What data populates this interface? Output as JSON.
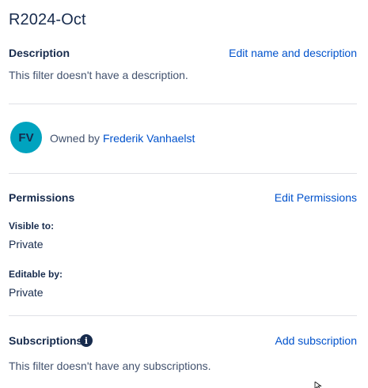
{
  "filter": {
    "title": "R2024-Oct"
  },
  "description": {
    "heading": "Description",
    "edit_link": "Edit name and description",
    "text": "This filter doesn't have a description."
  },
  "owner": {
    "avatar_initials": "FV",
    "prefix": "Owned by ",
    "name": "Frederik Vanhaelst"
  },
  "permissions": {
    "heading": "Permissions",
    "edit_link": "Edit Permissions",
    "visible_label": "Visible to:",
    "visible_value": "Private",
    "editable_label": "Editable by:",
    "editable_value": "Private"
  },
  "subscriptions": {
    "heading": "Subscriptions",
    "info_icon": "info-icon",
    "add_link": "Add subscription",
    "text": "This filter doesn't have any subscriptions."
  },
  "colors": {
    "text": "#172b4d",
    "muted": "#42526e",
    "link": "#0052cc",
    "avatar": "#00a3bf",
    "divider": "#dfe1e6"
  }
}
